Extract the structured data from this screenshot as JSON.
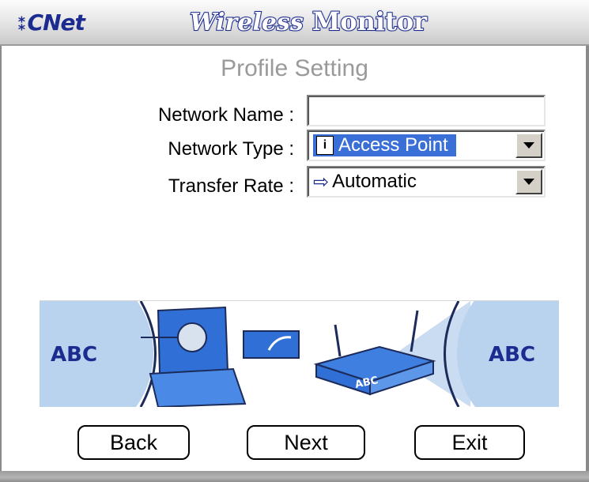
{
  "header": {
    "brand": "CNet",
    "app_title_part1": "Wireless",
    "app_title_part2": "Monitor"
  },
  "section_title": "Profile Setting",
  "form": {
    "network_name_label": "Network Name :",
    "network_name_value": "",
    "network_type_label": "Network Type :",
    "network_type_value": "Access Point",
    "network_type_icon": "access-point-icon",
    "transfer_rate_label": "Transfer Rate :",
    "transfer_rate_value": "Automatic",
    "transfer_rate_icon": "arrow-icon"
  },
  "banner": {
    "left_text": "ABC",
    "router_text": "ABC",
    "right_text": "ABC",
    "accent_color": "#2f6fd6",
    "circle_color": "#b9d3ee"
  },
  "buttons": {
    "back": "Back",
    "next": "Next",
    "exit": "Exit"
  },
  "colors": {
    "brand_blue": "#1c2b8f",
    "selection_blue": "#3b6fd8",
    "section_title_gray": "#9a9a9a"
  }
}
